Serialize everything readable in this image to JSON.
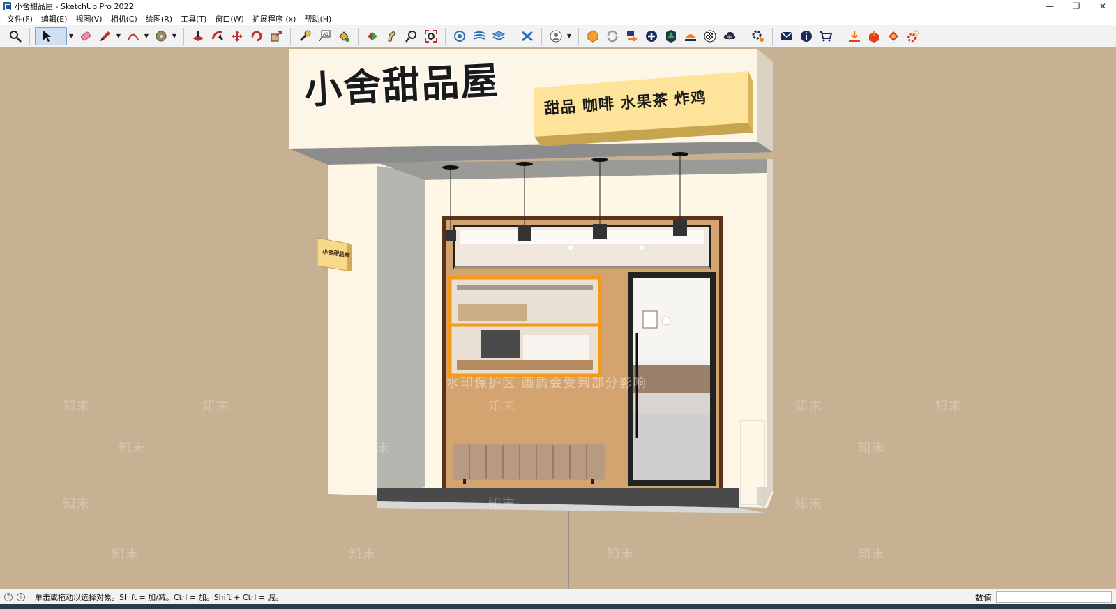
{
  "window": {
    "title": "小舍甜品屋 - SketchUp Pro 2022",
    "minimize_glyph": "—",
    "restore_glyph": "❐",
    "close_glyph": "✕"
  },
  "menu": [
    {
      "label": "文件(F)"
    },
    {
      "label": "编辑(E)"
    },
    {
      "label": "视图(V)"
    },
    {
      "label": "相机(C)"
    },
    {
      "label": "绘图(R)"
    },
    {
      "label": "工具(T)"
    },
    {
      "label": "窗口(W)"
    },
    {
      "label": "扩展程序 (x)"
    },
    {
      "label": "帮助(H)"
    }
  ],
  "toolbar_icons": [
    "zoom-icon",
    "select-icon",
    "eraser-icon",
    "pencil-icon",
    "arc-icon",
    "paint-icon",
    "push-pull-icon",
    "follow-me-icon",
    "move-icon",
    "rotate-icon",
    "scale-icon",
    "tape-measure-icon",
    "text-icon",
    "paint-bucket-icon",
    "section-plane-icon",
    "walk-icon",
    "zoom-window-icon",
    "zoom-extents-icon",
    "component-icon",
    "sandbox-icon",
    "layers-icon",
    "styles-icon",
    "user-icon",
    "warehouse-icon",
    "refresh-icon",
    "transfer-icon",
    "add-icon",
    "tree-icon",
    "materials-icon",
    "checker-icon",
    "cloud-upload-icon",
    "settings-icon",
    "mail-icon",
    "info-icon",
    "cart-icon",
    "import-icon",
    "export-icon",
    "plugin-icon",
    "gear-icon"
  ],
  "scene": {
    "sign_main": "小舍甜品屋",
    "sign_sub": "甜品 咖啡 水果茶 炸鸡",
    "blade_sign": "小舍甜品屋",
    "watermark_notice": "水印保护区   画质会受到部分影响",
    "watermark_brand": "知末",
    "colors": {
      "background": "#c6b192",
      "facade": "#fdf6e6",
      "sign_yellow": "#fde49a",
      "wood": "#d3a470",
      "frame_dark": "#5a3219",
      "window_frame": "#f39a1a"
    }
  },
  "status": {
    "hint": "单击或拖动以选择对象。Shift = 加/减。Ctrl = 加。Shift + Ctrl = 减。",
    "measurements_label": "数值",
    "measurements_value": ""
  }
}
